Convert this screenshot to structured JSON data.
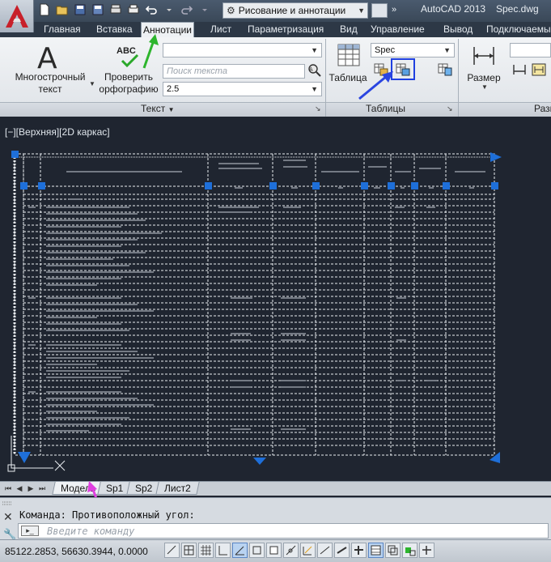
{
  "titlebar": {
    "app_title": "AutoCAD 2013",
    "file_name": "Spec.dwg",
    "workspace": "Рисование и аннотации",
    "more": "»"
  },
  "ribbon_tabs": [
    "Главная",
    "Вставка",
    "Аннотации",
    "Лист",
    "Параметризация",
    "Вид",
    "Управление",
    "Вывод",
    "Подключаемые"
  ],
  "active_tab": "Аннотации",
  "text_panel": {
    "mtext_label_1": "Многострочный",
    "mtext_label_2": "текст",
    "spell_label_1": "Проверить",
    "spell_label_2": "орфографию",
    "abc": "ABC",
    "search_placeholder": "Поиск текста",
    "height_value": "2.5",
    "panel_title": "Текст"
  },
  "tables_panel": {
    "table_label": "Таблица",
    "style_value": "Spec",
    "panel_title": "Таблицы"
  },
  "dimension_panel": {
    "size_label": "Размер",
    "panel_title_partial": "Разм"
  },
  "viewport": {
    "label": "[−][Верхняя][2D каркас]"
  },
  "layout_tabs": [
    "Модель",
    "Sp1",
    "Sp2",
    "Лист2"
  ],
  "active_layout": "Модель",
  "command": {
    "history": "Команда: Противоположный угол:",
    "placeholder": "Введите команду"
  },
  "status": {
    "coordinates": "85122.2853, 56630.3944, 0.0000"
  },
  "colors": {
    "drawing_bg": "#1f2530",
    "grip_blue": "#1e6fd9",
    "annotation_green": "#2db52d",
    "annotation_blue": "#2a45e0",
    "annotation_magenta": "#e040e0"
  }
}
